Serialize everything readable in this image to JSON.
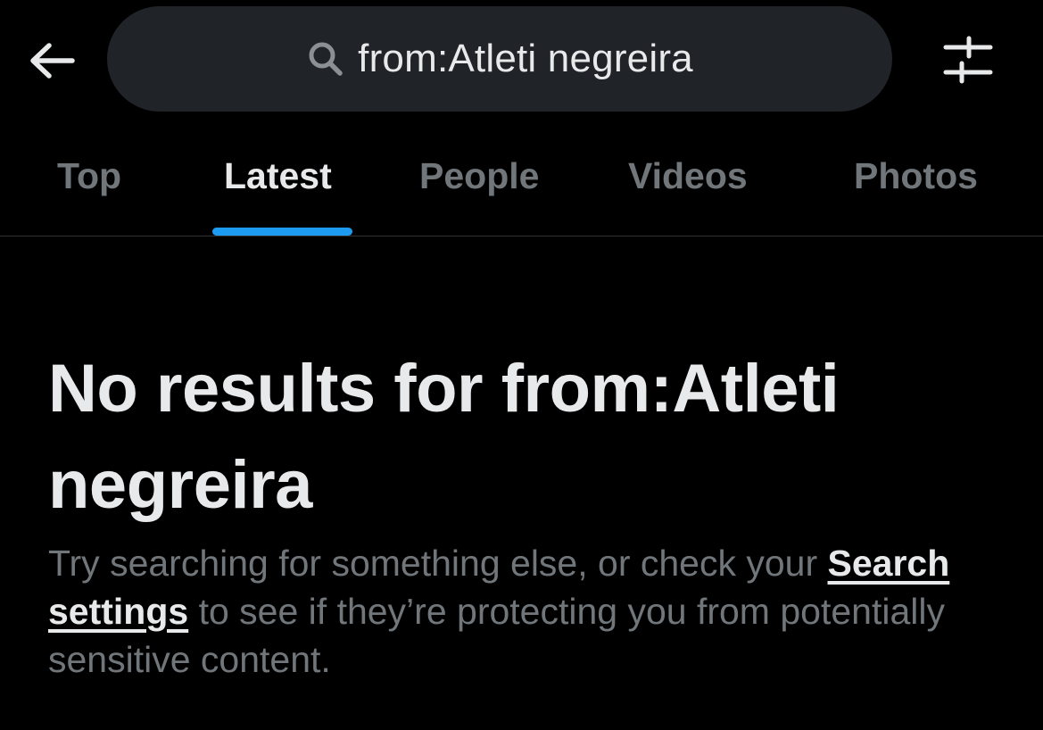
{
  "search": {
    "query": "from:Atleti negreira"
  },
  "icons": {
    "back": "arrow-left-icon",
    "search": "search-icon",
    "filter": "sliders-icon"
  },
  "tabs": [
    {
      "label": "Top",
      "active": false
    },
    {
      "label": "Latest",
      "active": true
    },
    {
      "label": "People",
      "active": false
    },
    {
      "label": "Videos",
      "active": false
    },
    {
      "label": "Photos",
      "active": false
    }
  ],
  "empty_state": {
    "title": "No results for from:Atleti negreira",
    "desc_before": "Try searching for something else, or check your ",
    "link_label": "Search settings",
    "desc_after": " to see if they’re protecting you from potentially sensitive content."
  },
  "colors": {
    "background": "#000000",
    "accent": "#1d9bf0",
    "text_primary": "#e7e9ea",
    "text_secondary": "#71767b",
    "pill": "#202327"
  }
}
